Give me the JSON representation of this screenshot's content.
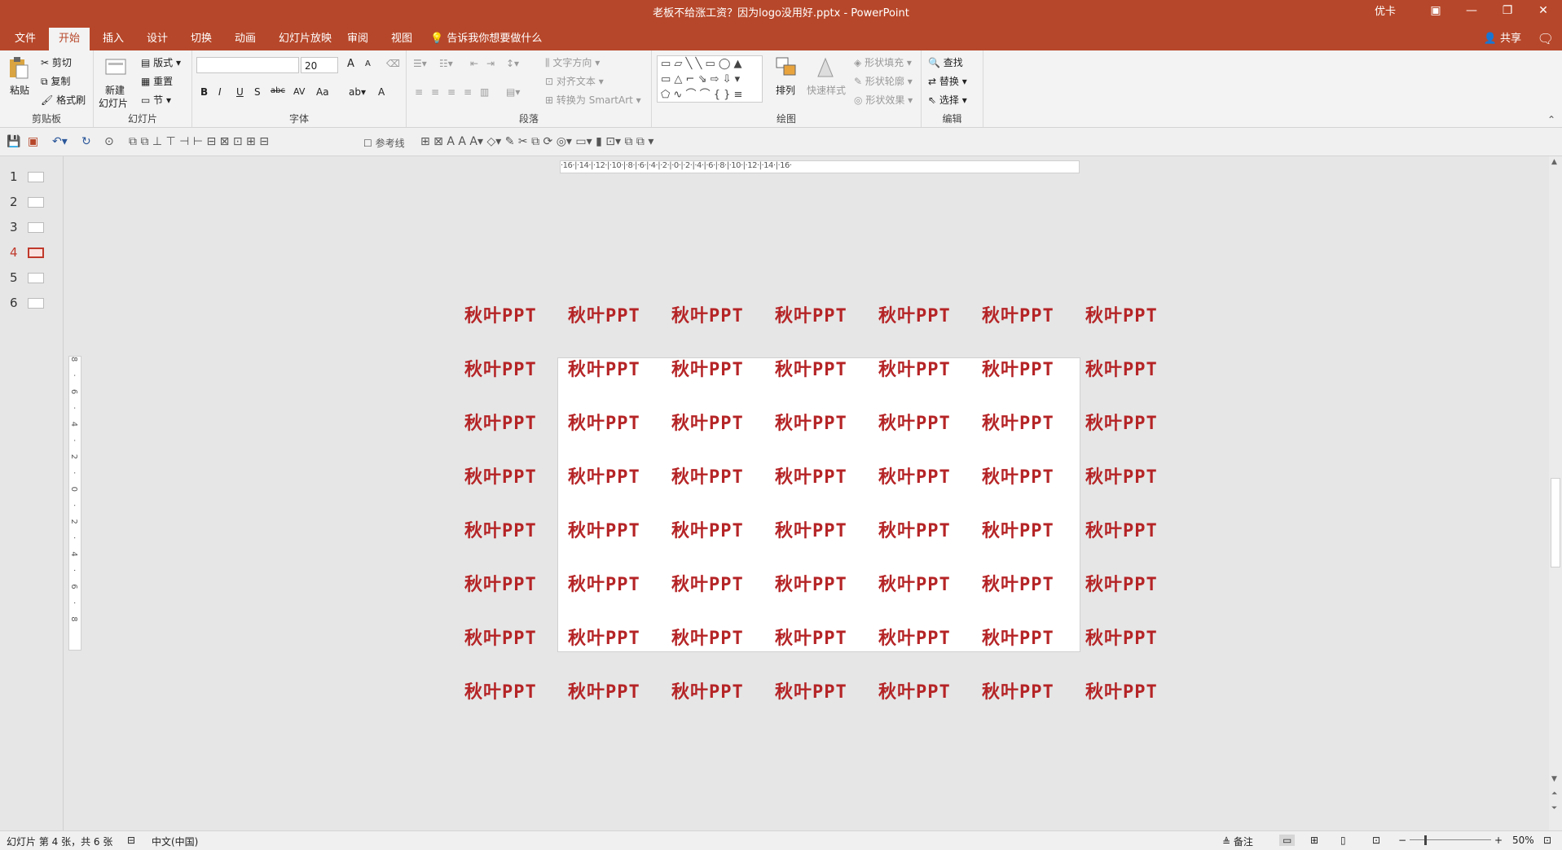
{
  "titlebar": {
    "doc_title": "老板不给涨工资？因为logo没用好.pptx  -  PowerPoint",
    "account": "优卡",
    "minimize": "—",
    "restore": "❐",
    "close": "✕",
    "ribbon_opts": "▣"
  },
  "tabs": [
    {
      "label": "文件"
    },
    {
      "label": "开始"
    },
    {
      "label": "插入"
    },
    {
      "label": "设计"
    },
    {
      "label": "切换"
    },
    {
      "label": "动画"
    },
    {
      "label": "幻灯片放映"
    },
    {
      "label": "审阅"
    },
    {
      "label": "视图"
    }
  ],
  "tellme": "告诉我你想要做什么",
  "share": "共享",
  "ribbon": {
    "clipboard": {
      "label": "剪贴板",
      "paste": "粘贴",
      "cut": "剪切",
      "copy": "复制",
      "format_painter": "格式刷"
    },
    "slides": {
      "label": "幻灯片",
      "new_slide_1": "新建",
      "new_slide_2": "幻灯片",
      "layout": "版式",
      "reset": "重置",
      "section": "节"
    },
    "font": {
      "label": "字体",
      "font_name": "",
      "font_size": "20",
      "bold": "B",
      "italic": "I",
      "underline": "U",
      "shadow": "S",
      "strike": "abc",
      "spacing": "AV",
      "case": "Aa",
      "color": "A",
      "grow": "A",
      "shrink": "A"
    },
    "paragraph": {
      "label": "段落",
      "text_direction": "文字方向",
      "align_text": "对齐文本",
      "smartart": "转换为 SmartArt"
    },
    "drawing": {
      "label": "绘图",
      "arrange": "排列",
      "quick_styles": "快速样式",
      "fill": "形状填充",
      "outline": "形状轮廓",
      "effects": "形状效果"
    },
    "editing": {
      "label": "编辑",
      "find": "查找",
      "replace": "替换",
      "select": "选择"
    }
  },
  "qat": {
    "guides": "参考线"
  },
  "thumbs": [
    {
      "num": "1"
    },
    {
      "num": "2"
    },
    {
      "num": "3"
    },
    {
      "num": "4"
    },
    {
      "num": "5"
    },
    {
      "num": "6"
    }
  ],
  "hruler_text": "·16·|·14·|·12·|·10·|·8·|·6·|·4·|·2·|·0·|·2·|·4·|·6·|·8·|·10·|·12·|·14·|·16·",
  "vruler_text": "8 · 6 · 4 · 2 · 0 · 2 · 4 · 6 · 8",
  "logo_text": "秋叶PPT",
  "status": {
    "slide_info": "幻灯片 第 4 张，共 6 张",
    "language": "中文(中国)",
    "notes": "备注",
    "zoom": "50%"
  },
  "colors": {
    "accent": "#b7472a",
    "logo": "#b52426"
  }
}
